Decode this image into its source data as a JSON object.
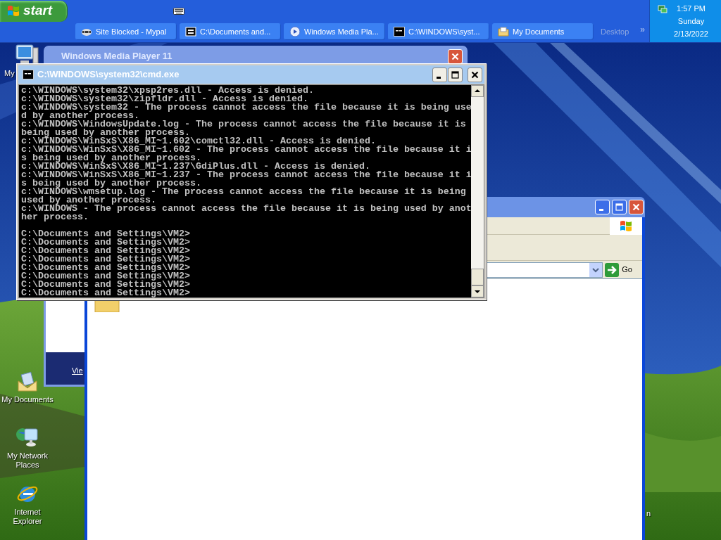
{
  "taskbar": {
    "start": "start",
    "tasks": [
      {
        "kind": "raccoon",
        "label": "Site Blocked - Mypal",
        "selected": false
      },
      {
        "kind": "archive",
        "label": "C:\\Documents and...",
        "selected": false
      },
      {
        "kind": "player",
        "label": "Windows Media Pla...",
        "selected": false
      },
      {
        "kind": "console",
        "label": "C:\\WINDOWS\\syst...",
        "selected": false
      },
      {
        "kind": "folder",
        "label": "My Documents",
        "selected": false
      }
    ],
    "toolbar_label": "Desktop",
    "chevron": "»",
    "clock": {
      "time": "1:57 PM",
      "day": "Sunday",
      "date": "2/13/2022"
    }
  },
  "desktop_icons": [
    {
      "kind": "computer",
      "label": "My"
    },
    {
      "kind": "documents",
      "label": "My Documents"
    },
    {
      "kind": "network",
      "label": "My Network Places"
    },
    {
      "kind": "browser",
      "label": "Internet Explorer"
    },
    {
      "kind": "hidden",
      "label": "n"
    }
  ],
  "media_player_window": {
    "title": "Windows Media Player 11",
    "link": "Vie"
  },
  "explorer_window": {
    "go_button": "Go"
  },
  "console_window": {
    "title": "C:\\WINDOWS\\system32\\cmd.exe",
    "lines": [
      "c:\\WINDOWS\\system32\\xpsp2res.dll - Access is denied.",
      "c:\\WINDOWS\\system32\\zipfldr.dll - Access is denied.",
      "c:\\WINDOWS\\system32 - The process cannot access the file because it is being use",
      "d by another process.",
      "c:\\WINDOWS\\WindowsUpdate.log - The process cannot access the file because it is",
      "being used by another process.",
      "c:\\WINDOWS\\WinSxS\\X86_MI~1.602\\comctl32.dll - Access is denied.",
      "c:\\WINDOWS\\WinSxS\\X86_MI~1.602 - The process cannot access the file because it i",
      "s being used by another process.",
      "c:\\WINDOWS\\WinSxS\\X86_MI~1.237\\GdiPlus.dll - Access is denied.",
      "c:\\WINDOWS\\WinSxS\\X86_MI~1.237 - The process cannot access the file because it i",
      "s being used by another process.",
      "c:\\WINDOWS\\wmsetup.log - The process cannot access the file because it is being",
      "used by another process.",
      "c:\\WINDOWS - The process cannot access the file because it is being used by anot",
      "her process."
    ],
    "prompts": [
      "C:\\Documents and Settings\\VM2>",
      "C:\\Documents and Settings\\VM2>",
      "C:\\Documents and Settings\\VM2>",
      "C:\\Documents and Settings\\VM2>",
      "C:\\Documents and Settings\\VM2>",
      "C:\\Documents and Settings\\VM2>",
      "C:\\Documents and Settings\\VM2>",
      "C:\\Documents and Settings\\VM2>"
    ]
  }
}
